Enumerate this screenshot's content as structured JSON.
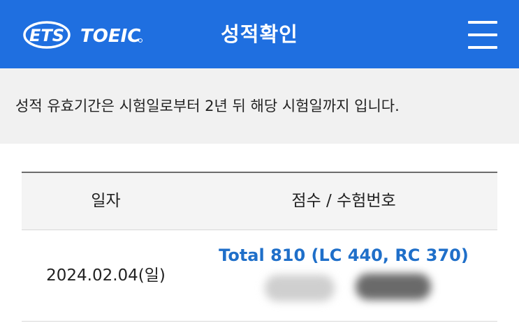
{
  "header": {
    "logo_text": "ETS TOEIC",
    "title": "성적확인",
    "menu_icon": "hamburger-menu-icon",
    "background_color": "#1f6fe0"
  },
  "notice": {
    "text": "성적 유효기간은 시험일로부터 2년 뒤 해당 시험일까지 입니다."
  },
  "table": {
    "columns": [
      "일자",
      "점수 / 수험번호"
    ],
    "rows": [
      {
        "date": "2024.02.04(일)",
        "score": "Total 810 (LC 440, RC 370)"
      }
    ],
    "score_color": "#1f6fc9"
  }
}
